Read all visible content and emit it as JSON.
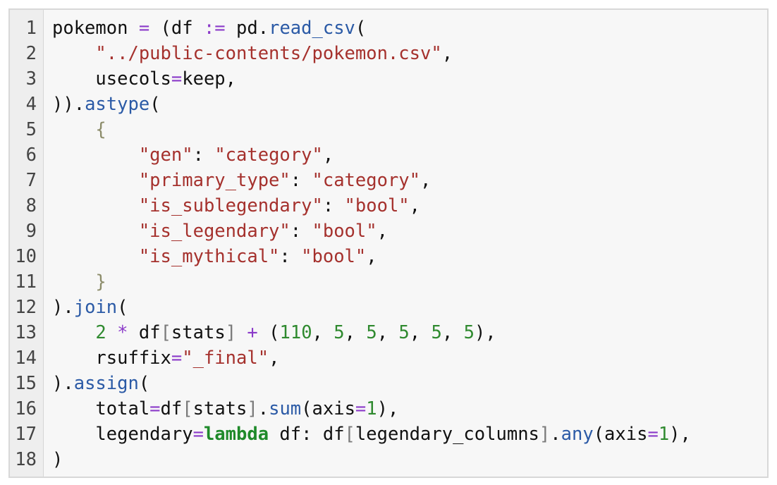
{
  "editor": {
    "lines": [
      {
        "n": "1",
        "tokens": [
          {
            "t": "pokemon ",
            "c": ""
          },
          {
            "t": "=",
            "c": "t-op"
          },
          {
            "t": " (df ",
            "c": ""
          },
          {
            "t": ":=",
            "c": "t-op"
          },
          {
            "t": " pd.",
            "c": ""
          },
          {
            "t": "read_csv",
            "c": "t-fn"
          },
          {
            "t": "(",
            "c": ""
          }
        ]
      },
      {
        "n": "2",
        "tokens": [
          {
            "t": "    ",
            "c": ""
          },
          {
            "t": "\"../public-contents/pokemon.csv\"",
            "c": "t-str"
          },
          {
            "t": ",",
            "c": ""
          }
        ]
      },
      {
        "n": "3",
        "tokens": [
          {
            "t": "    usecols",
            "c": ""
          },
          {
            "t": "=",
            "c": "t-op"
          },
          {
            "t": "keep,",
            "c": ""
          }
        ]
      },
      {
        "n": "4",
        "tokens": [
          {
            "t": ")).",
            "c": ""
          },
          {
            "t": "astype",
            "c": "t-fn"
          },
          {
            "t": "(",
            "c": ""
          }
        ]
      },
      {
        "n": "5",
        "tokens": [
          {
            "t": "    ",
            "c": ""
          },
          {
            "t": "{",
            "c": "t-br2"
          }
        ]
      },
      {
        "n": "6",
        "tokens": [
          {
            "t": "        ",
            "c": ""
          },
          {
            "t": "\"gen\"",
            "c": "t-str"
          },
          {
            "t": ": ",
            "c": ""
          },
          {
            "t": "\"category\"",
            "c": "t-str"
          },
          {
            "t": ",",
            "c": ""
          }
        ]
      },
      {
        "n": "7",
        "tokens": [
          {
            "t": "        ",
            "c": ""
          },
          {
            "t": "\"primary_type\"",
            "c": "t-str"
          },
          {
            "t": ": ",
            "c": ""
          },
          {
            "t": "\"category\"",
            "c": "t-str"
          },
          {
            "t": ",",
            "c": ""
          }
        ]
      },
      {
        "n": "8",
        "tokens": [
          {
            "t": "        ",
            "c": ""
          },
          {
            "t": "\"is_sublegendary\"",
            "c": "t-str"
          },
          {
            "t": ": ",
            "c": ""
          },
          {
            "t": "\"bool\"",
            "c": "t-str"
          },
          {
            "t": ",",
            "c": ""
          }
        ]
      },
      {
        "n": "9",
        "tokens": [
          {
            "t": "        ",
            "c": ""
          },
          {
            "t": "\"is_legendary\"",
            "c": "t-str"
          },
          {
            "t": ": ",
            "c": ""
          },
          {
            "t": "\"bool\"",
            "c": "t-str"
          },
          {
            "t": ",",
            "c": ""
          }
        ]
      },
      {
        "n": "10",
        "tokens": [
          {
            "t": "        ",
            "c": ""
          },
          {
            "t": "\"is_mythical\"",
            "c": "t-str"
          },
          {
            "t": ": ",
            "c": ""
          },
          {
            "t": "\"bool\"",
            "c": "t-str"
          },
          {
            "t": ",",
            "c": ""
          }
        ]
      },
      {
        "n": "11",
        "tokens": [
          {
            "t": "    ",
            "c": ""
          },
          {
            "t": "}",
            "c": "t-br2"
          }
        ]
      },
      {
        "n": "12",
        "tokens": [
          {
            "t": ").",
            "c": ""
          },
          {
            "t": "join",
            "c": "t-fn"
          },
          {
            "t": "(",
            "c": ""
          }
        ]
      },
      {
        "n": "13",
        "tokens": [
          {
            "t": "    ",
            "c": ""
          },
          {
            "t": "2",
            "c": "t-num"
          },
          {
            "t": " ",
            "c": ""
          },
          {
            "t": "*",
            "c": "t-op"
          },
          {
            "t": " df",
            "c": ""
          },
          {
            "t": "[",
            "c": "t-br"
          },
          {
            "t": "stats",
            "c": ""
          },
          {
            "t": "]",
            "c": "t-br"
          },
          {
            "t": " ",
            "c": ""
          },
          {
            "t": "+",
            "c": "t-op"
          },
          {
            "t": " (",
            "c": ""
          },
          {
            "t": "110",
            "c": "t-num"
          },
          {
            "t": ", ",
            "c": ""
          },
          {
            "t": "5",
            "c": "t-num"
          },
          {
            "t": ", ",
            "c": ""
          },
          {
            "t": "5",
            "c": "t-num"
          },
          {
            "t": ", ",
            "c": ""
          },
          {
            "t": "5",
            "c": "t-num"
          },
          {
            "t": ", ",
            "c": ""
          },
          {
            "t": "5",
            "c": "t-num"
          },
          {
            "t": ", ",
            "c": ""
          },
          {
            "t": "5",
            "c": "t-num"
          },
          {
            "t": "),",
            "c": ""
          }
        ]
      },
      {
        "n": "14",
        "tokens": [
          {
            "t": "    rsuffix",
            "c": ""
          },
          {
            "t": "=",
            "c": "t-op"
          },
          {
            "t": "\"_final\"",
            "c": "t-str"
          },
          {
            "t": ",",
            "c": ""
          }
        ]
      },
      {
        "n": "15",
        "tokens": [
          {
            "t": ").",
            "c": ""
          },
          {
            "t": "assign",
            "c": "t-fn"
          },
          {
            "t": "(",
            "c": ""
          }
        ]
      },
      {
        "n": "16",
        "tokens": [
          {
            "t": "    total",
            "c": ""
          },
          {
            "t": "=",
            "c": "t-op"
          },
          {
            "t": "df",
            "c": ""
          },
          {
            "t": "[",
            "c": "t-br"
          },
          {
            "t": "stats",
            "c": ""
          },
          {
            "t": "]",
            "c": "t-br"
          },
          {
            "t": ".",
            "c": ""
          },
          {
            "t": "sum",
            "c": "t-fn"
          },
          {
            "t": "(axis",
            "c": ""
          },
          {
            "t": "=",
            "c": "t-op"
          },
          {
            "t": "1",
            "c": "t-num"
          },
          {
            "t": "),",
            "c": ""
          }
        ]
      },
      {
        "n": "17",
        "tokens": [
          {
            "t": "    legendary",
            "c": ""
          },
          {
            "t": "=",
            "c": "t-op"
          },
          {
            "t": "lambda",
            "c": "t-kw"
          },
          {
            "t": " df: df",
            "c": ""
          },
          {
            "t": "[",
            "c": "t-br"
          },
          {
            "t": "legendary_columns",
            "c": ""
          },
          {
            "t": "]",
            "c": "t-br"
          },
          {
            "t": ".",
            "c": ""
          },
          {
            "t": "any",
            "c": "t-fn"
          },
          {
            "t": "(axis",
            "c": ""
          },
          {
            "t": "=",
            "c": "t-op"
          },
          {
            "t": "1",
            "c": "t-num"
          },
          {
            "t": "),",
            "c": ""
          }
        ]
      },
      {
        "n": "18",
        "tokens": [
          {
            "t": ")",
            "c": ""
          }
        ]
      }
    ]
  }
}
